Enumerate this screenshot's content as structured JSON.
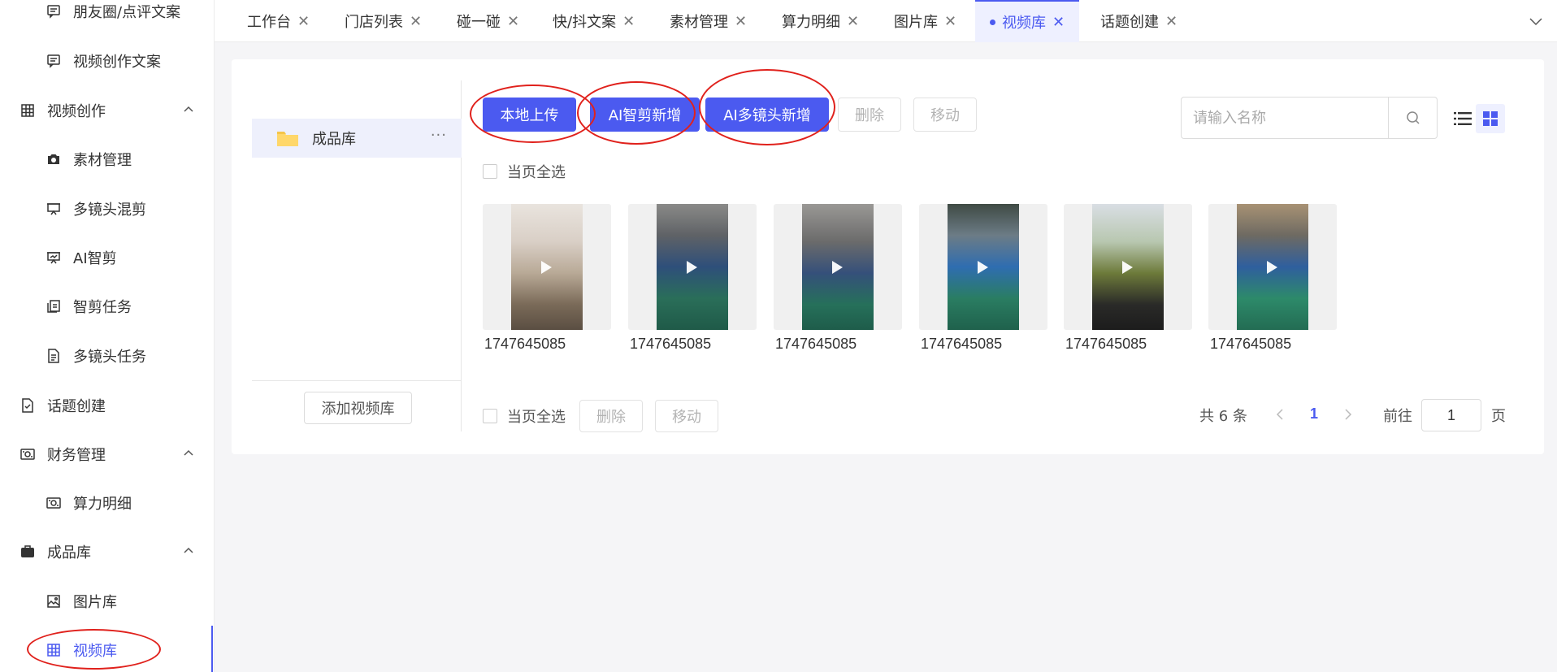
{
  "sidebar": {
    "items": [
      {
        "label": "朋友圈/点评文案",
        "level": 2,
        "icon": "message-square-icon"
      },
      {
        "label": "视频创作文案",
        "level": 2,
        "icon": "message-square-icon"
      },
      {
        "label": "视频创作",
        "level": 1,
        "icon": "grid-table-icon",
        "expanded": true
      },
      {
        "label": "素材管理",
        "level": 2,
        "icon": "camera-icon"
      },
      {
        "label": "多镜头混剪",
        "level": 2,
        "icon": "presentation-icon"
      },
      {
        "label": "AI智剪",
        "level": 2,
        "icon": "presentation-chart-icon"
      },
      {
        "label": "智剪任务",
        "level": 2,
        "icon": "copy-icon"
      },
      {
        "label": "多镜头任务",
        "level": 2,
        "icon": "document-icon"
      },
      {
        "label": "话题创建",
        "level": 1,
        "icon": "document-check-icon"
      },
      {
        "label": "财务管理",
        "level": 1,
        "icon": "money-icon",
        "expanded": true
      },
      {
        "label": "算力明细",
        "level": 2,
        "icon": "money-icon"
      },
      {
        "label": "成品库",
        "level": 1,
        "icon": "briefcase-icon",
        "expanded": true
      },
      {
        "label": "图片库",
        "level": 2,
        "icon": "image-icon"
      },
      {
        "label": "视频库",
        "level": 2,
        "icon": "grid-table-icon",
        "active": true
      }
    ]
  },
  "tabs": [
    {
      "label": "工作台"
    },
    {
      "label": "门店列表"
    },
    {
      "label": "碰一碰"
    },
    {
      "label": "快/抖文案"
    },
    {
      "label": "素材管理"
    },
    {
      "label": "算力明细"
    },
    {
      "label": "图片库"
    },
    {
      "label": "视频库",
      "active": true
    },
    {
      "label": "话题创建"
    }
  ],
  "library": {
    "folder_name": "成品库",
    "more": "···",
    "add_button": "添加视频库"
  },
  "toolbar": {
    "local_upload": "本地上传",
    "ai_smart_add": "AI智剪新增",
    "ai_multi_add": "AI多镜头新增",
    "delete": "删除",
    "move": "移动"
  },
  "search": {
    "placeholder": "请输入名称",
    "value": ""
  },
  "select_all_label": "当页全选",
  "videos": [
    {
      "name": "1747645085"
    },
    {
      "name": "1747645085"
    },
    {
      "name": "1747645085"
    },
    {
      "name": "1747645085"
    },
    {
      "name": "1747645085"
    },
    {
      "name": "1747645085"
    }
  ],
  "bottom_bar": {
    "select_all_label": "当页全选",
    "delete": "删除",
    "move": "移动"
  },
  "pagination": {
    "total": "共 6 条",
    "current_page": "1",
    "goto_label": "前往",
    "goto_value": "1",
    "page_suffix": "页"
  },
  "colors": {
    "accent": "#4b5af0",
    "annotation": "#e0211c"
  }
}
